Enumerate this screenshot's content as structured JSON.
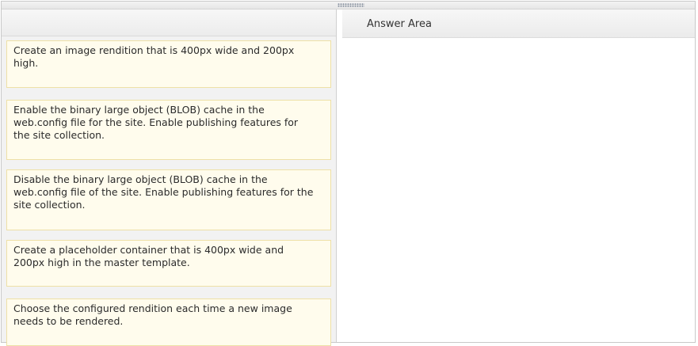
{
  "answer_area": {
    "title": "Answer Area"
  },
  "options": [
    {
      "text": "Create an image rendition that is 400px wide and 200px high."
    },
    {
      "text": "Enable the binary large object (BLOB) cache in the web.config file for the site. Enable publishing features for the site collection."
    },
    {
      "text": "Disable the binary large object (BLOB) cache in the web.config file of the site. Enable publishing features for the site collection."
    },
    {
      "text": "Create a placeholder container that is 400px wide and 200px high in the master template."
    },
    {
      "text": "Choose the configured rendition each time a new image needs to be rendered."
    }
  ],
  "colors": {
    "card_background": "#fffced",
    "card_border": "#eee0a6",
    "pane_background": "#f2f2f2"
  },
  "icons": {
    "splitter_grip": "grip-dots-icon"
  }
}
